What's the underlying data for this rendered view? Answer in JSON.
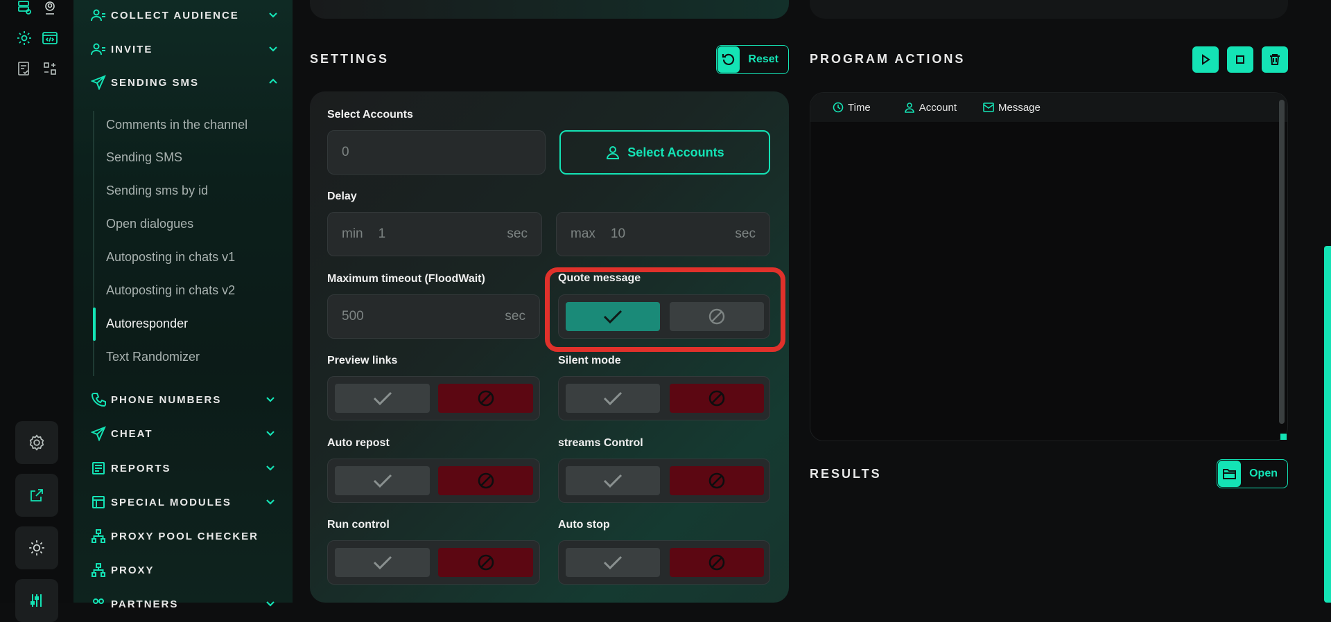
{
  "sidebar": {
    "items": [
      {
        "label": "COLLECT AUDIENCE",
        "icon": "users-icon",
        "expanded": false
      },
      {
        "label": "INVITE",
        "icon": "users-icon",
        "expanded": false
      },
      {
        "label": "SENDING SMS",
        "icon": "send-icon",
        "expanded": true
      },
      {
        "label": "PHONE NUMBERS",
        "icon": "phone-icon",
        "expanded": false
      },
      {
        "label": "CHEAT",
        "icon": "send-icon",
        "expanded": false
      },
      {
        "label": "REPORTS",
        "icon": "report-icon",
        "expanded": false
      },
      {
        "label": "SPECIAL MODULES",
        "icon": "modules-icon",
        "expanded": false
      },
      {
        "label": "PROXY POOL CHECKER",
        "icon": "network-icon"
      },
      {
        "label": "PROXY",
        "icon": "network-icon"
      },
      {
        "label": "PARTNERS",
        "icon": "partners-icon",
        "expanded": false
      }
    ],
    "sub_items": [
      "Comments in the channel",
      "Sending SMS",
      "Sending sms by id",
      "Open dialogues",
      "Autoposting in chats v1",
      "Autoposting in chats v2",
      "Autoresponder",
      "Text Randomizer"
    ],
    "active_sub": "Autoresponder"
  },
  "settings": {
    "title": "SETTINGS",
    "reset_label": "Reset",
    "select_accounts_label": "Select Accounts",
    "accounts_value": "0",
    "select_accounts_button": "Select Accounts",
    "delay_label": "Delay",
    "delay_min_prefix": "min",
    "delay_min_value": "1",
    "delay_max_prefix": "max",
    "delay_max_value": "10",
    "unit": "sec",
    "timeout_label": "Maximum timeout (FloodWait)",
    "timeout_value": "500",
    "quote_label": "Quote message",
    "quote_enabled": true,
    "toggles": [
      {
        "label": "Preview links",
        "enabled": false
      },
      {
        "label": "Silent mode",
        "enabled": false
      },
      {
        "label": "Auto repost",
        "enabled": false
      },
      {
        "label": "streams Control",
        "enabled": false
      },
      {
        "label": "Run control",
        "enabled": false
      },
      {
        "label": "Auto stop",
        "enabled": false
      }
    ]
  },
  "program_actions": {
    "title": "PROGRAM ACTIONS",
    "columns": [
      "Time",
      "Account",
      "Message"
    ]
  },
  "results": {
    "title": "RESULTS",
    "open_label": "Open"
  },
  "colors": {
    "accent": "#14e3b5",
    "danger": "#5c0712",
    "highlight": "#e0312b"
  }
}
